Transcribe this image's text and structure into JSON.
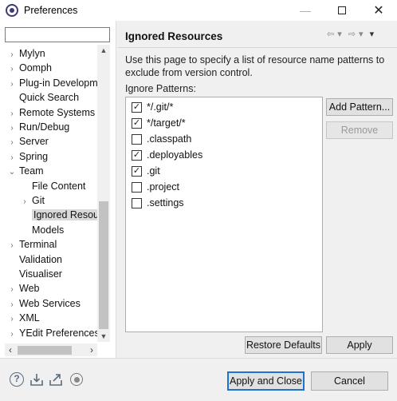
{
  "window": {
    "title": "Preferences"
  },
  "filter": {
    "placeholder": ""
  },
  "tree": [
    {
      "label": "Mylyn",
      "twisty": "›",
      "indent": 0
    },
    {
      "label": "Oomph",
      "twisty": "›",
      "indent": 0
    },
    {
      "label": "Plug-in Developm",
      "twisty": "›",
      "indent": 0
    },
    {
      "label": "Quick Search",
      "twisty": "",
      "indent": 0
    },
    {
      "label": "Remote Systems",
      "twisty": "›",
      "indent": 0
    },
    {
      "label": "Run/Debug",
      "twisty": "›",
      "indent": 0
    },
    {
      "label": "Server",
      "twisty": "›",
      "indent": 0
    },
    {
      "label": "Spring",
      "twisty": "›",
      "indent": 0
    },
    {
      "label": "Team",
      "twisty": "⌄",
      "indent": 0
    },
    {
      "label": "File Content",
      "twisty": "",
      "indent": 1
    },
    {
      "label": "Git",
      "twisty": "›",
      "indent": 1
    },
    {
      "label": "Ignored Resou",
      "twisty": "",
      "indent": 1,
      "selected": true
    },
    {
      "label": "Models",
      "twisty": "",
      "indent": 1
    },
    {
      "label": "Terminal",
      "twisty": "›",
      "indent": 0
    },
    {
      "label": "Validation",
      "twisty": "",
      "indent": 0
    },
    {
      "label": "Visualiser",
      "twisty": "",
      "indent": 0
    },
    {
      "label": "Web",
      "twisty": "›",
      "indent": 0
    },
    {
      "label": "Web Services",
      "twisty": "›",
      "indent": 0
    },
    {
      "label": "XML",
      "twisty": "›",
      "indent": 0
    },
    {
      "label": "YEdit Preferences",
      "twisty": "›",
      "indent": 0
    }
  ],
  "page": {
    "title": "Ignored Resources",
    "description": "Use this page to specify a list of resource name patterns to exclude from version control.",
    "patterns_label": "Ignore Patterns:"
  },
  "patterns": [
    {
      "text": "*/.git/*",
      "checked": true
    },
    {
      "text": "*/target/*",
      "checked": true
    },
    {
      "text": ".classpath",
      "checked": false
    },
    {
      "text": ".deployables",
      "checked": true
    },
    {
      "text": ".git",
      "checked": true
    },
    {
      "text": ".project",
      "checked": false
    },
    {
      "text": ".settings",
      "checked": false
    }
  ],
  "buttons": {
    "add_pattern": "Add Pattern...",
    "remove": "Remove",
    "restore_defaults": "Restore Defaults",
    "apply": "Apply",
    "apply_and_close": "Apply and Close",
    "cancel": "Cancel"
  },
  "icons": {
    "help": "help-icon",
    "import": "import-icon",
    "export": "export-icon",
    "record": "record-icon"
  }
}
